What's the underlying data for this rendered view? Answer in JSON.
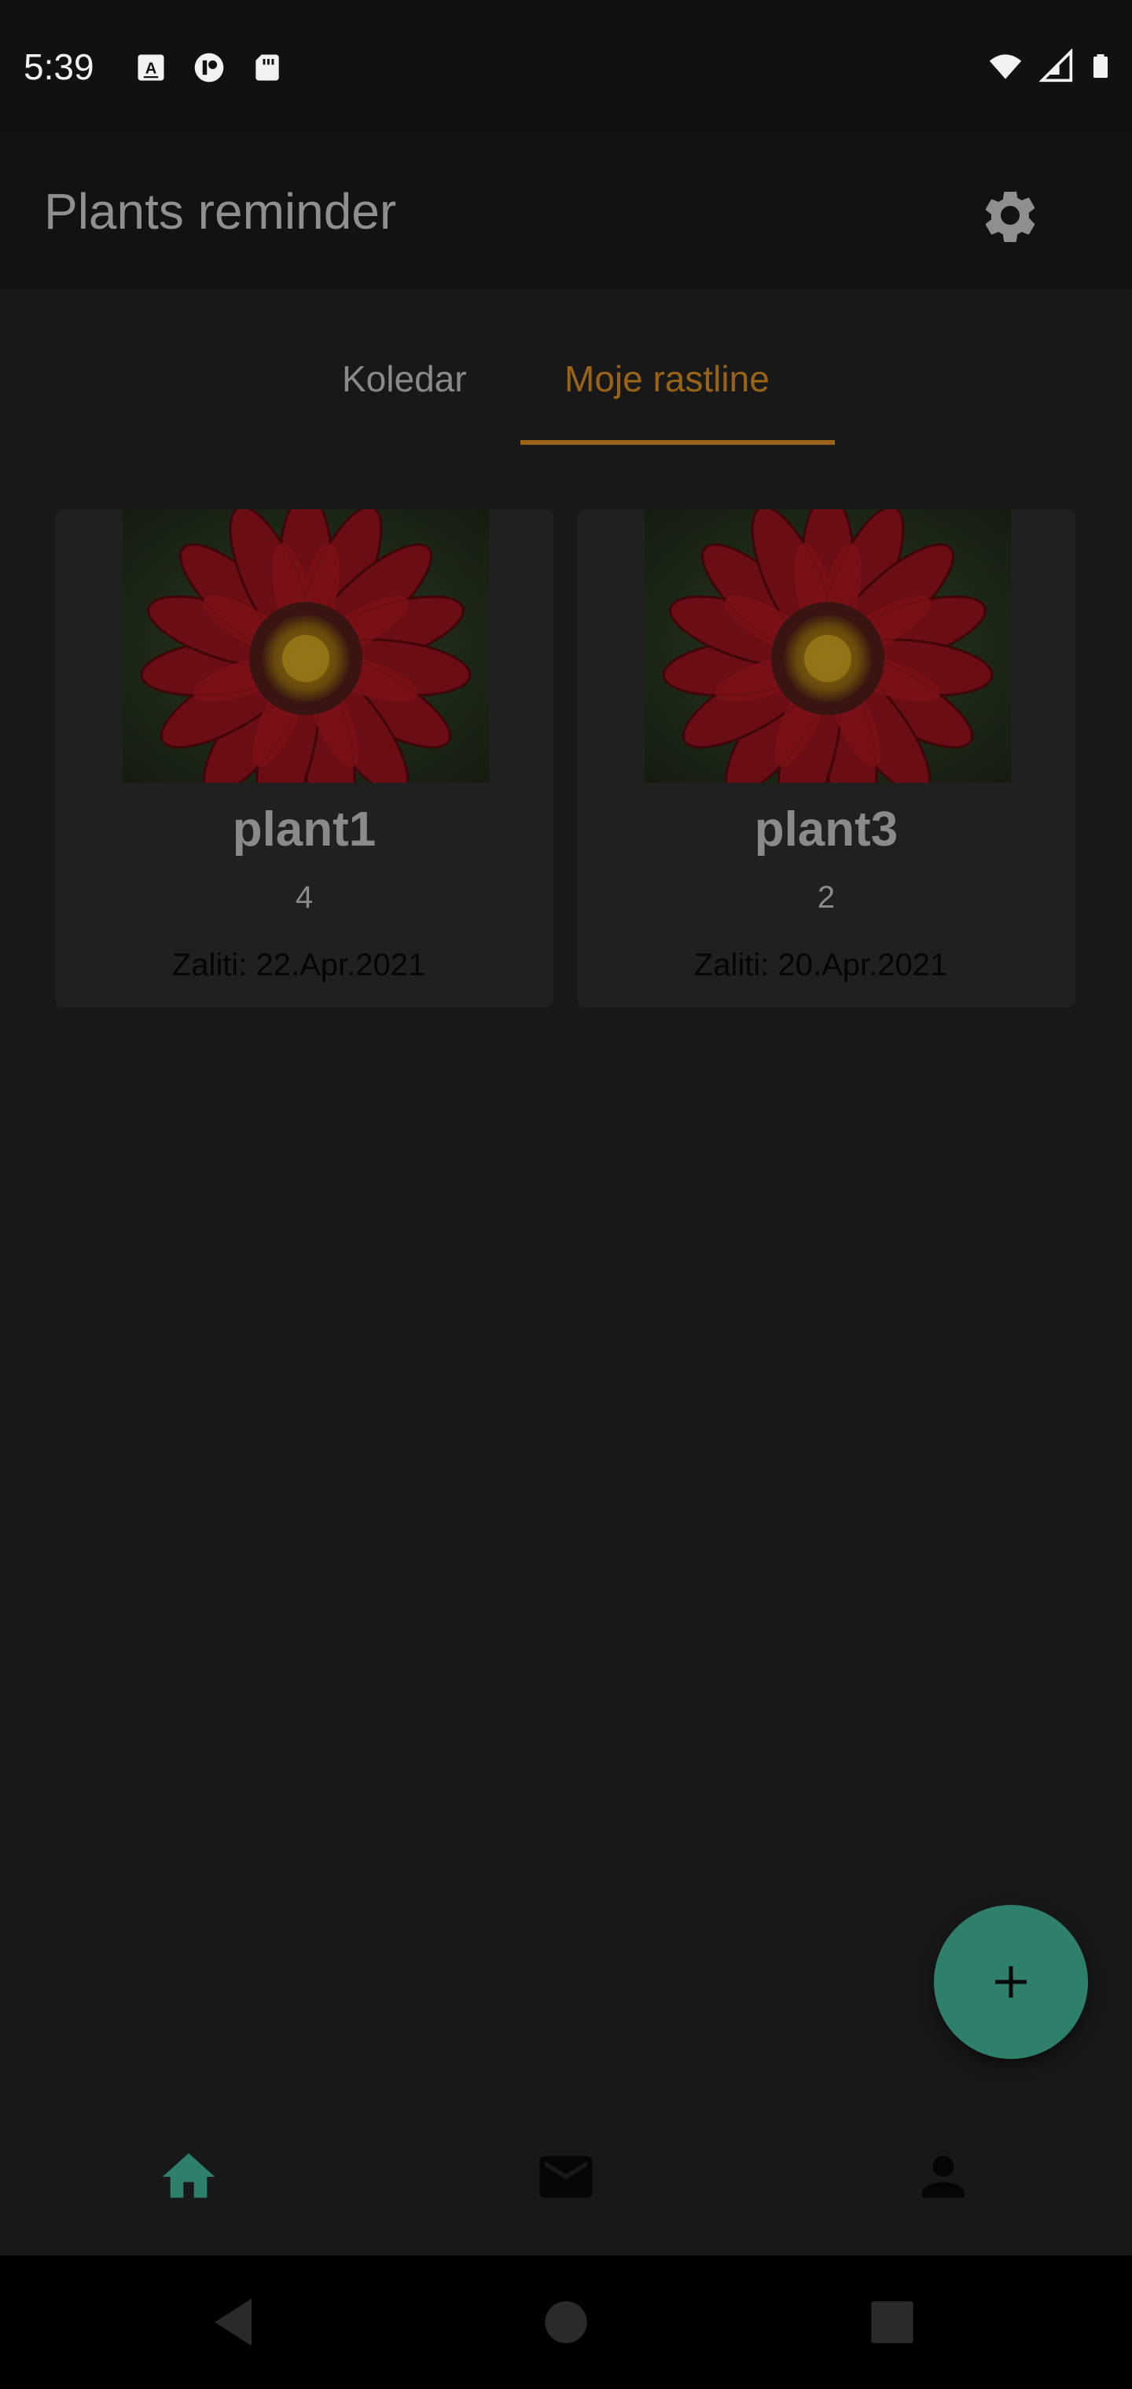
{
  "status_bar": {
    "time": "5:39",
    "left_icons": [
      "a-keyboard-icon",
      "pi-app-icon",
      "sd-card-icon"
    ],
    "right_icons": [
      "wifi-icon",
      "cell-signal-icon",
      "battery-icon"
    ]
  },
  "app_bar": {
    "title": "Plants reminder",
    "settings_icon": "gear-icon"
  },
  "tabs": [
    {
      "label": "Koledar",
      "selected": false
    },
    {
      "label": "Moje rastline",
      "selected": true
    }
  ],
  "plants": [
    {
      "name": "plant1",
      "count": "4",
      "water": "Zaliti: 22.Apr.2021",
      "image": "red-flower-photo"
    },
    {
      "name": "plant3",
      "count": "2",
      "water": "Zaliti: 20.Apr.2021",
      "image": "red-flower-photo"
    }
  ],
  "fab": {
    "icon": "plus-icon"
  },
  "bottom_nav": [
    {
      "icon": "home-icon",
      "active": true
    },
    {
      "icon": "mail-icon",
      "active": false
    },
    {
      "icon": "person-icon",
      "active": false
    }
  ],
  "system_nav": [
    "back-icon",
    "home-circle-icon",
    "recents-icon"
  ],
  "colors": {
    "background": "#181818",
    "app_bar": "#121212",
    "accent_tab": "#9a6418",
    "fab": "#2e7f6b",
    "nav_active": "#2e7f6b",
    "card": "#202020"
  }
}
